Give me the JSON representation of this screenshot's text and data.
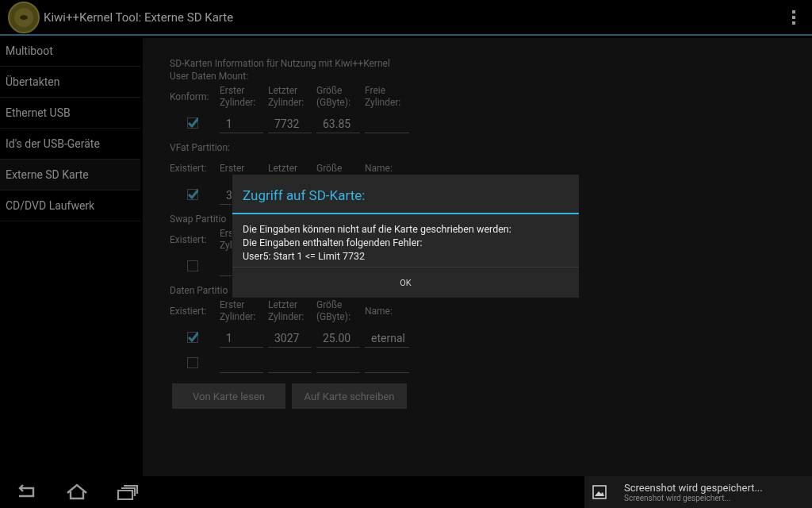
{
  "action_bar": {
    "title": "Kiwi++Kernel Tool: Externe SD Karte"
  },
  "sidebar": {
    "items": [
      {
        "label": "Multiboot",
        "selected": false
      },
      {
        "label": "Übertakten",
        "selected": false
      },
      {
        "label": "Ethernet USB",
        "selected": false
      },
      {
        "label": "Id's der USB-Geräte",
        "selected": false
      },
      {
        "label": "Externe SD Karte",
        "selected": true
      },
      {
        "label": "CD/DVD Laufwerk",
        "selected": false
      }
    ]
  },
  "form": {
    "heading": "SD-Karten Information für Nutzung mit Kiwi++Kernel",
    "sections": [
      {
        "title": "User Daten Mount:",
        "row_label": "Konform:",
        "headers": [
          "Erster\nZylinder:",
          "Letzter\nZylinder:",
          "Größe\n(GByte):",
          "Freie\nZylinder:"
        ],
        "rows": [
          {
            "checked": true,
            "fields": [
              {
                "kind": "text",
                "value": "1"
              },
              {
                "kind": "text",
                "value": "7732"
              },
              {
                "kind": "text",
                "value": "63.85"
              },
              {
                "kind": "empty"
              }
            ]
          }
        ]
      },
      {
        "title": "VFat Partition:",
        "row_label": "Existiert:",
        "headers": [
          "Erster",
          "Letzter",
          "Größe",
          "Name:"
        ],
        "rows": [
          {
            "checked": true,
            "fields": [
              {
                "kind": "text",
                "value": "3"
              }
            ]
          }
        ]
      },
      {
        "title": "Swap Partitio",
        "row_label": "Existiert:",
        "headers": [
          "Ers\nZyl"
        ],
        "rows": [
          {
            "checked": false,
            "fields": [
              {
                "kind": "empty"
              }
            ]
          }
        ]
      },
      {
        "title": "Daten Partitio",
        "row_label": "Existiert:",
        "headers": [
          "Erster\nZylinder:",
          "Letzter\nZylinder:",
          "Größe\n(GByte):",
          "Name:"
        ],
        "rows": [
          {
            "checked": true,
            "fields": [
              {
                "kind": "text",
                "value": "1"
              },
              {
                "kind": "text",
                "value": "3027"
              },
              {
                "kind": "text",
                "value": "25.00"
              },
              {
                "kind": "text",
                "value": "eternal"
              }
            ]
          },
          {
            "checked": false,
            "fields": [
              {
                "kind": "empty"
              },
              {
                "kind": "empty"
              },
              {
                "kind": "empty"
              },
              {
                "kind": "empty"
              }
            ]
          }
        ]
      }
    ],
    "buttons": [
      "Von Karte lesen",
      "Auf Karte schreiben"
    ]
  },
  "dialog": {
    "title": "Zugriff auf SD-Karte:",
    "message": [
      "Die Eingaben können nicht auf die Karte geschrieben werden:",
      "Die Eingaben enthalten folgenden Fehler:",
      "User5: Start 1 <= Limit 7732"
    ],
    "button": "OK"
  },
  "notification": {
    "title": "Screenshot wird gespeichert...",
    "text": "Screenshot wird gespeichert..."
  }
}
